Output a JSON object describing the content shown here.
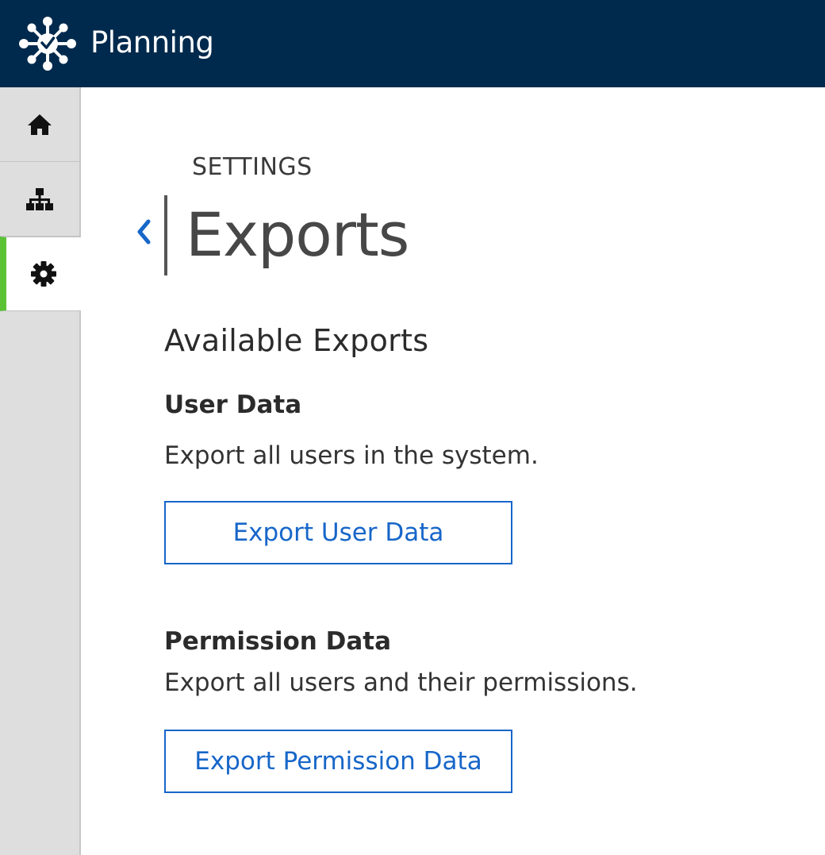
{
  "header": {
    "app_title": "Planning",
    "logo_icon": "network-hub-logo-icon",
    "background_color": "#002a4d"
  },
  "sidebar": {
    "items": [
      {
        "name": "home",
        "icon": "home-icon",
        "active": false
      },
      {
        "name": "org-chart",
        "icon": "org-chart-icon",
        "active": false
      },
      {
        "name": "settings",
        "icon": "gear-icon",
        "active": true
      }
    ],
    "active_indicator_color": "#5bc236"
  },
  "page": {
    "section_label": "SETTINGS",
    "title": "Exports",
    "back_icon": "chevron-left-icon"
  },
  "exports": {
    "heading": "Available Exports",
    "user": {
      "title": "User Data",
      "description": "Export all users in the system.",
      "button_label": "Export User Data"
    },
    "permission": {
      "title": "Permission Data",
      "description": "Export all users and their permissions.",
      "button_label": "Export Permission Data"
    },
    "accent_color": "#1766c9"
  }
}
